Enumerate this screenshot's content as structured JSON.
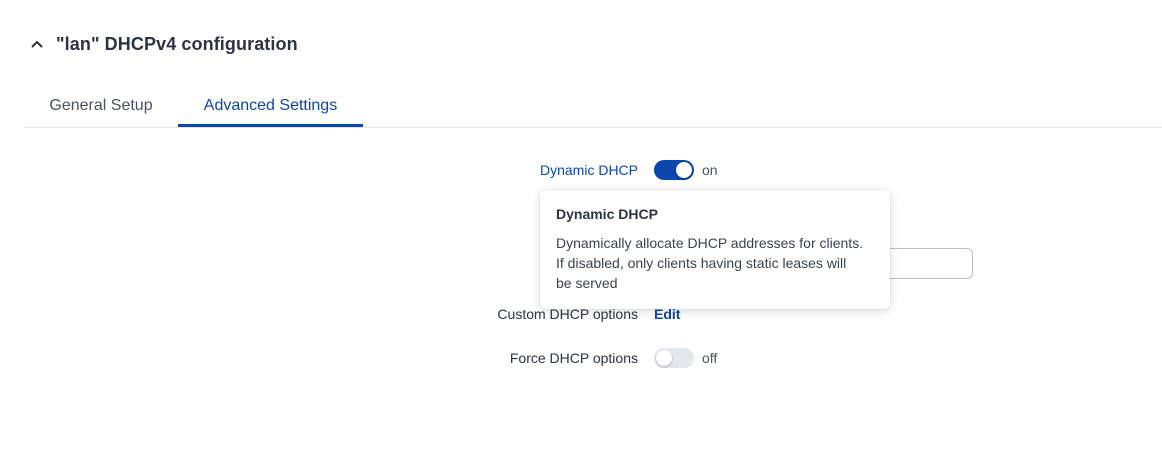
{
  "section": {
    "title": "\"lan\" DHCPv4 configuration",
    "expanded": true
  },
  "tabs": [
    {
      "label": "General Setup",
      "active": false
    },
    {
      "label": "Advanced Settings",
      "active": true
    }
  ],
  "settings": {
    "dynamic_dhcp": {
      "label": "Dynamic DHCP",
      "state": "on",
      "enabled": true
    },
    "custom_dhcp_options": {
      "label": "Custom DHCP options",
      "action": "Edit"
    },
    "force_dhcp_options": {
      "label": "Force DHCP options",
      "state": "off",
      "enabled": false
    }
  },
  "tooltip": {
    "title": "Dynamic DHCP",
    "lines": [
      "Dynamically allocate DHCP addresses for clients.",
      "If disabled, only clients having static leases will",
      "be served"
    ]
  },
  "colors": {
    "accent": "#0b47ad",
    "text": "#2b3440",
    "toggle_off": "#e4e7eb",
    "divider": "#e2e6ea"
  },
  "icons": {
    "collapse": "chevron-up-icon"
  }
}
